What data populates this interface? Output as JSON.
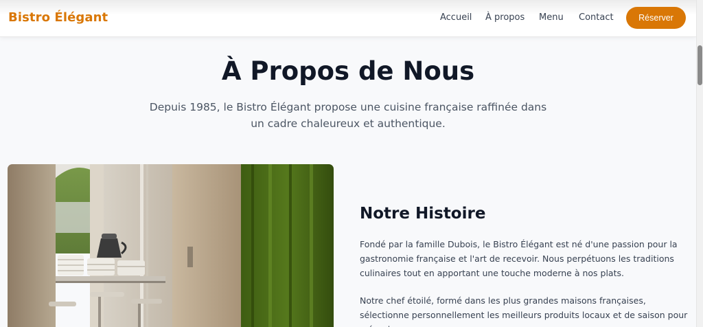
{
  "nav": {
    "brand": "Bistro Élégant",
    "links": [
      "Accueil",
      "À propos",
      "Menu",
      "Contact"
    ],
    "cta": "Réserver"
  },
  "about": {
    "title": "À Propos de Nous",
    "subtitle": "Depuis 1985, le Bistro Élégant propose une cuisine française raffinée dans un cadre chaleureux et authentique."
  },
  "history": {
    "title": "Notre Histoire",
    "paragraphs": [
      "Fondé par la famille Dubois, le Bistro Élégant est né d'une passion pour la gastronomie française et l'art de recevoir. Nous perpétuons les traditions culinaires tout en apportant une touche moderne à nos plats.",
      "Notre chef étoilé, formé dans les plus grandes maisons françaises, sélectionne personnellement les meilleurs produits locaux et de saison pour créer des"
    ]
  },
  "colors": {
    "accent": "#d97706",
    "heading": "#111827",
    "text": "#374151",
    "background": "#f8f9fb"
  },
  "icons": {
    "photo": "restaurant-interior-photo"
  }
}
